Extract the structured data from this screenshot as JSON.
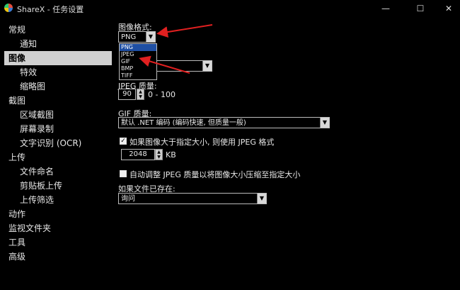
{
  "window": {
    "title": "ShareX - 任务设置",
    "minimize": "—",
    "maximize": "☐",
    "close": "✕"
  },
  "sidebar": {
    "items": [
      {
        "label": "常规",
        "level": 0
      },
      {
        "label": "通知",
        "level": 1
      },
      {
        "label": "图像",
        "level": 0,
        "selected": true
      },
      {
        "label": "特效",
        "level": 1
      },
      {
        "label": "缩略图",
        "level": 1
      },
      {
        "label": "截图",
        "level": 0
      },
      {
        "label": "区域截图",
        "level": 1
      },
      {
        "label": "屏幕录制",
        "level": 1
      },
      {
        "label": "文字识别 (OCR)",
        "level": 1
      },
      {
        "label": "上传",
        "level": 0
      },
      {
        "label": "文件命名",
        "level": 1
      },
      {
        "label": "剪贴板上传",
        "level": 1
      },
      {
        "label": "上传筛选",
        "level": 1
      },
      {
        "label": "动作",
        "level": 0
      },
      {
        "label": "监视文件夹",
        "level": 0
      },
      {
        "label": "工具",
        "level": 0
      },
      {
        "label": "高级",
        "level": 0
      }
    ]
  },
  "image": {
    "format_label": "图像格式:",
    "format_value": "PNG",
    "format_options": [
      "PNG",
      "JPEG",
      "GIF",
      "BMP",
      "TIFF"
    ],
    "jpeg_quality_label": "JPEG 质量:",
    "jpeg_quality_value": "90",
    "jpeg_quality_range": "0 - 100",
    "gif_quality_label": "GIF 质量:",
    "gif_quality_value": "默认 .NET 编码 (编码快速, 但质量一般)",
    "size_check_label": "如果图像大于指定大小, 则使用 JPEG 格式",
    "size_check_checked": true,
    "size_value": "2048",
    "size_unit": "KB",
    "auto_resize_label": "自动调整 JPEG 质量以将图像大小压缩至指定大小",
    "auto_resize_checked": false,
    "file_exists_label": "如果文件已存在:",
    "file_exists_value": "询问"
  }
}
